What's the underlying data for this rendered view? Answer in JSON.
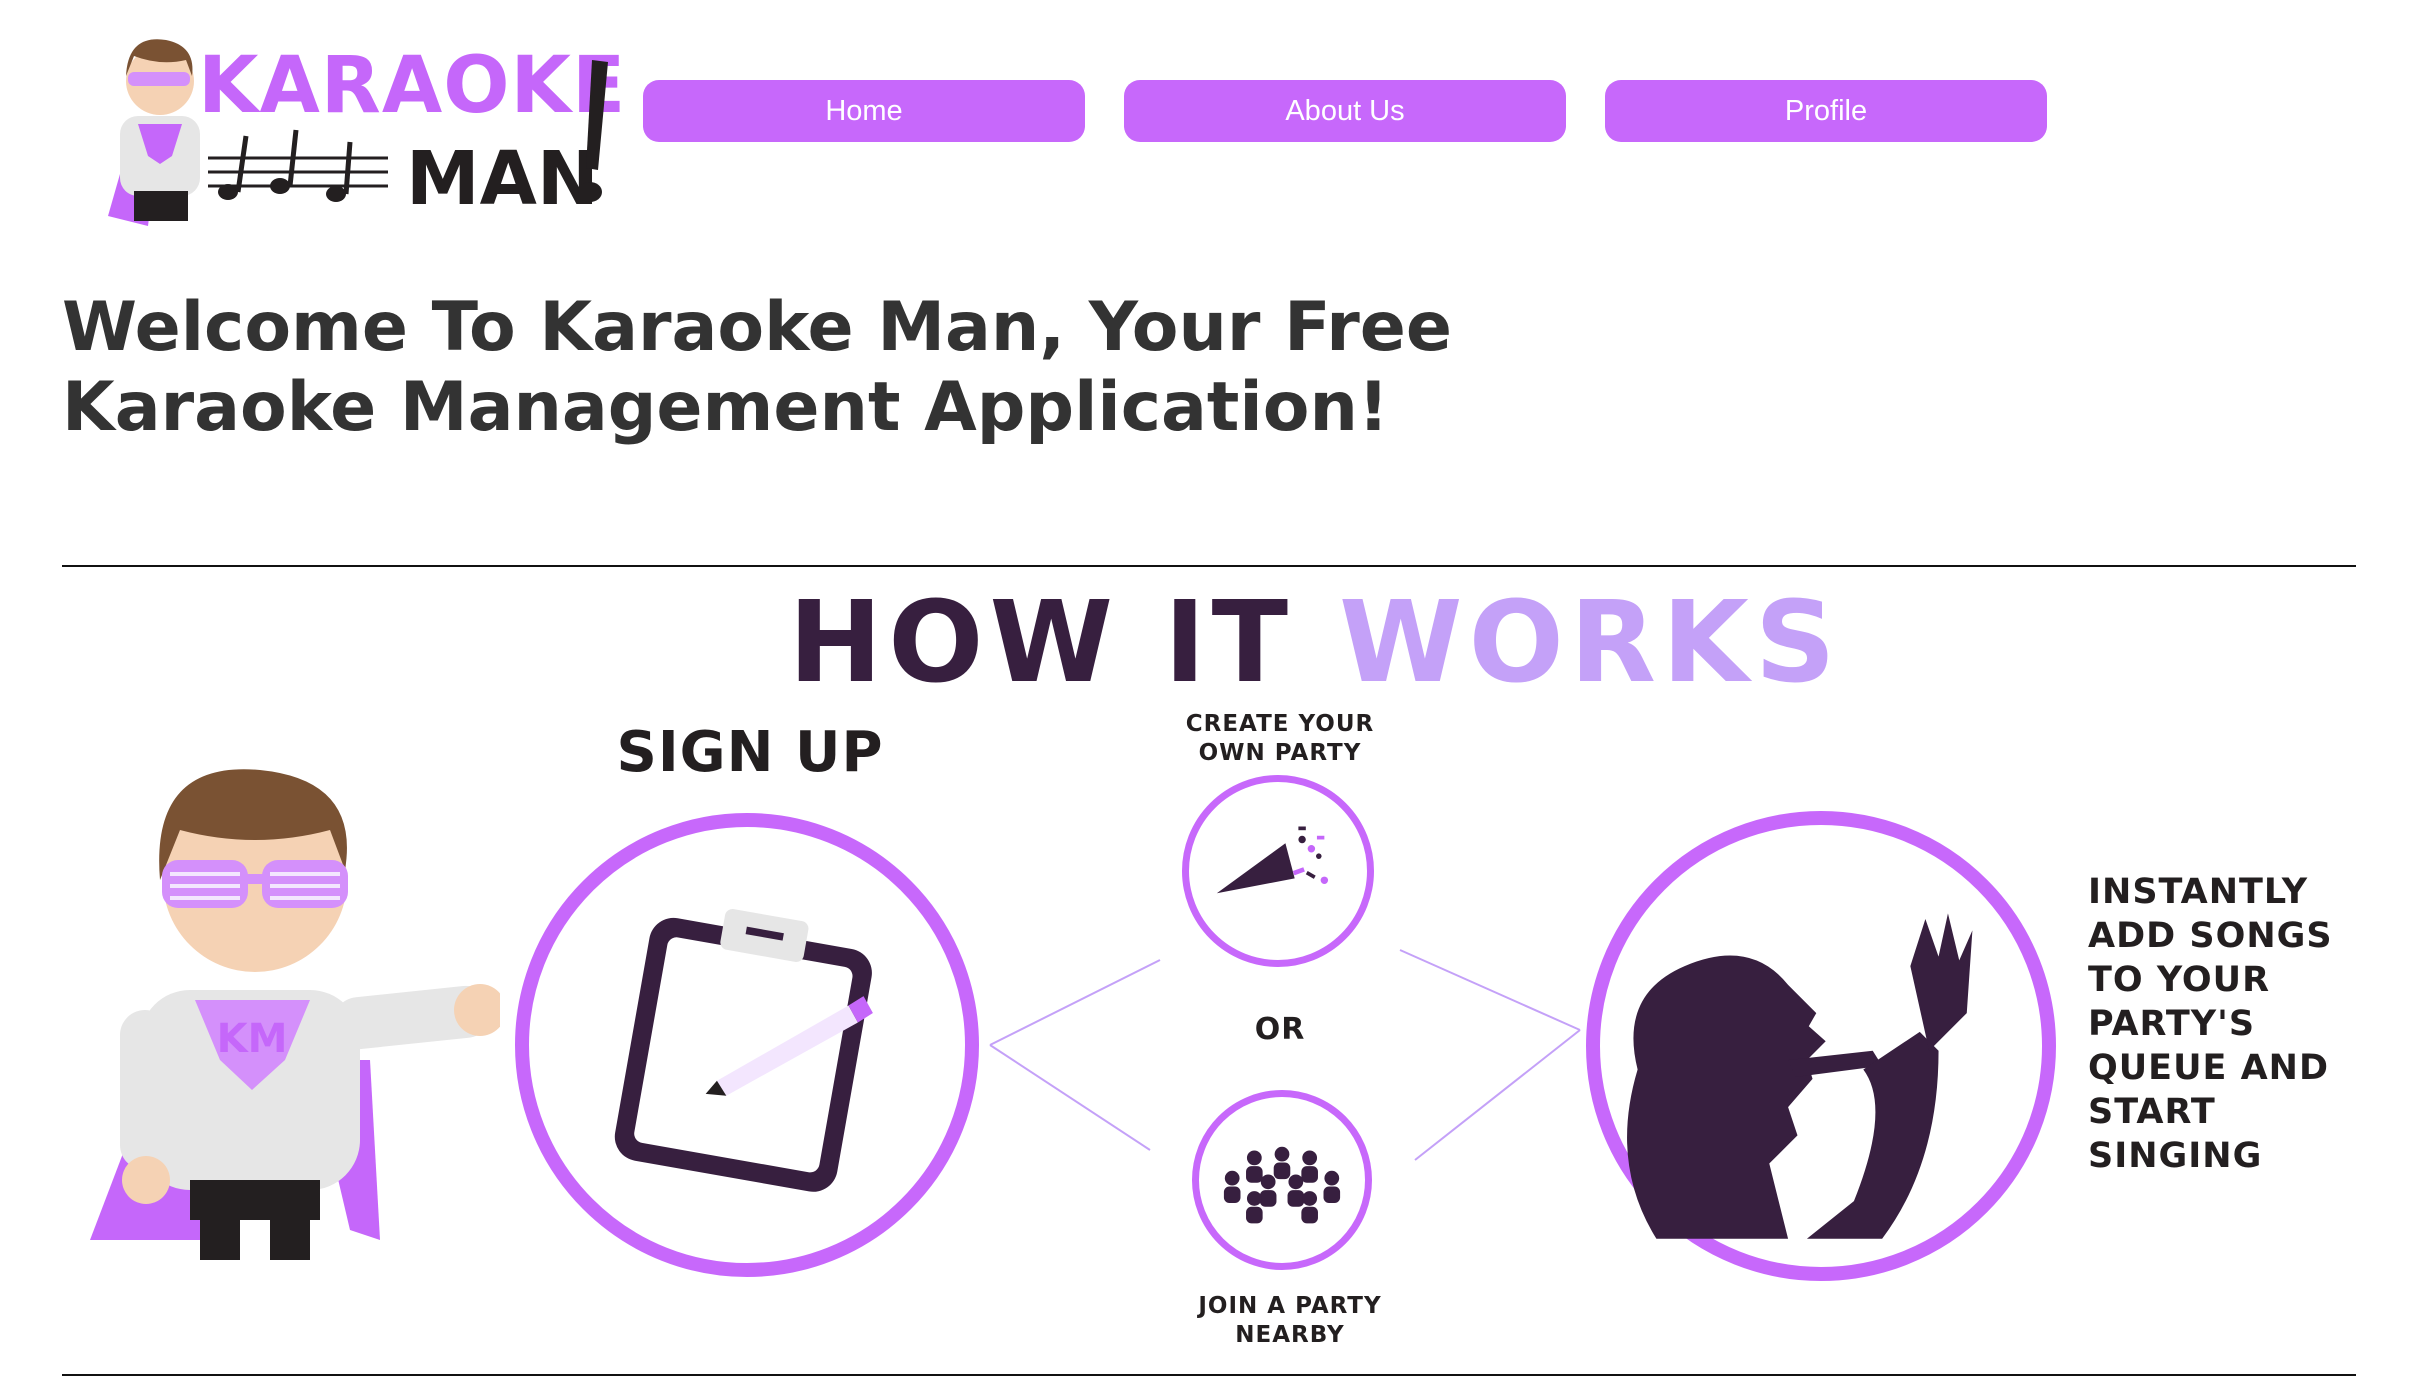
{
  "header": {
    "logo_top": "KARAOKE",
    "logo_bottom": "MAN",
    "nav": [
      {
        "label": "Home"
      },
      {
        "label": "About Us"
      },
      {
        "label": "Profile"
      }
    ]
  },
  "main": {
    "title": "Welcome To Karaoke Man, Your Free Karaoke Management Application!"
  },
  "how_it_works": {
    "title_part1": "HOW IT",
    "title_part2": "WORKS",
    "step_signup": "SIGN UP",
    "step_create": "CREATE YOUR OWN PARTY",
    "or_label": "OR",
    "step_join": "JOIN A PARTY NEARBY",
    "step_sing": "INSTANTLY ADD SONGS TO YOUR PARTY'S QUEUE AND START SINGING",
    "mascot_logo": "KM"
  },
  "colors": {
    "accent": "#c768fb",
    "dark_purple": "#371f3f",
    "light_purple": "#c4a1f8",
    "text": "#333333"
  },
  "icons": {
    "signup": "clipboard-pencil-icon",
    "create": "party-popper-icon",
    "join": "crowd-icon",
    "sing": "singer-silhouette-icon"
  }
}
